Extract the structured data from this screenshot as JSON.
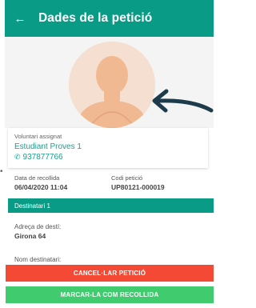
{
  "header": {
    "title": "Dades de la petició",
    "back_icon": "arrow-left-icon"
  },
  "photo": {
    "icon": "user-avatar-icon",
    "annotation_icon": "curved-arrow-icon"
  },
  "volunteer": {
    "label": "Voluntari assignat",
    "name": "Estudiant Proves 1",
    "phone": "937877766",
    "phone_icon": "phone-icon"
  },
  "details": {
    "date_label": "Data de recollida",
    "date_value": "06/04/2020 11:04",
    "code_label": "Codi petició",
    "code_value": "UP80121-000019"
  },
  "recipient": {
    "section_title": "Destinatari 1",
    "address_label": "Adreça de destí:",
    "address_value": "Girona 64",
    "name_label": "Nom destinatari:"
  },
  "actions": {
    "cancel_label": "CANCEL·LAR PETICIÓ",
    "mark_label": "MARCAR-LA COM RECOLLIDA"
  },
  "colors": {
    "primary": "#0a9b86",
    "link": "#1a9f8c",
    "danger": "#f44a35",
    "success": "#3fcb6e"
  }
}
